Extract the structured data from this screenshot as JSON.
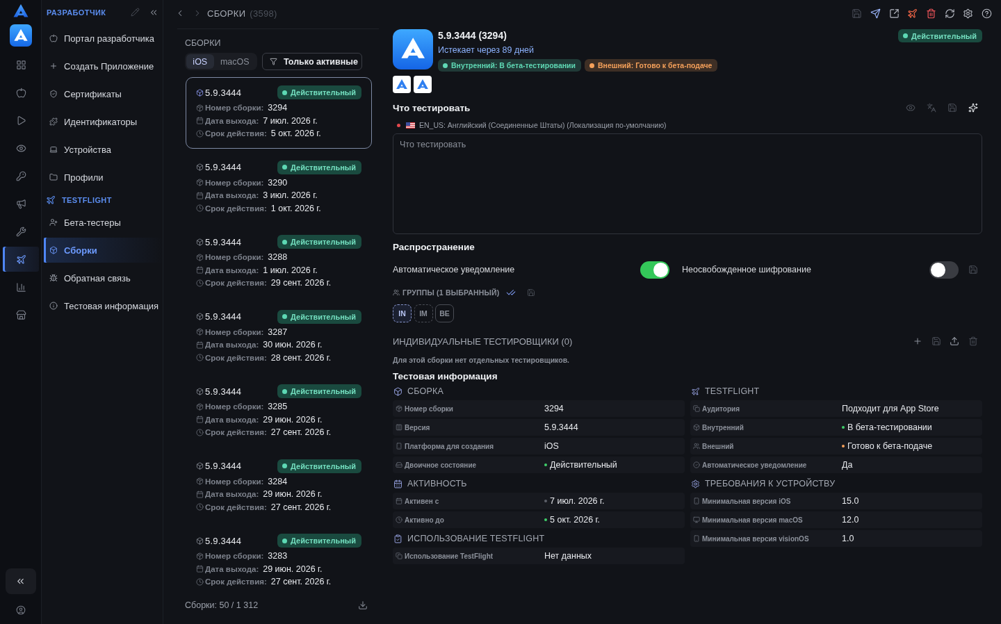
{
  "rail": {
    "items": [
      {
        "selected": false
      },
      {
        "selected": false
      },
      {
        "selected": false
      },
      {
        "selected": false
      },
      {
        "selected": false
      },
      {
        "selected": false
      },
      {
        "selected": false
      },
      {
        "selected": true
      },
      {
        "selected": false
      },
      {
        "selected": false
      }
    ]
  },
  "sidebar": {
    "sections": [
      {
        "title": "РАЗРАБОТЧИК",
        "items": [
          {
            "label": "Портал разработчика",
            "selected": false
          },
          {
            "label": "Создать Приложение",
            "selected": false
          },
          {
            "label": "Сертификаты",
            "selected": false
          },
          {
            "label": "Идентификаторы",
            "selected": false
          },
          {
            "label": "Устройства",
            "selected": false
          },
          {
            "label": "Профили",
            "selected": false
          }
        ]
      },
      {
        "title": "TESTFLIGHT",
        "items": [
          {
            "label": "Бета-тестеры",
            "selected": false
          },
          {
            "label": "Сборки",
            "selected": true
          },
          {
            "label": "Обратная связь",
            "selected": false
          },
          {
            "label": "Тестовая информация",
            "selected": false
          }
        ]
      }
    ]
  },
  "breadcrumb": {
    "title": "СБОРКИ",
    "count": "(3598)"
  },
  "toolbar": [
    {
      "disabled": true
    },
    {
      "disabled": false
    },
    {
      "disabled": false
    },
    {
      "disabled": false
    },
    {
      "disabled": false
    },
    {
      "disabled": false
    },
    {
      "disabled": false
    },
    {
      "disabled": false
    }
  ],
  "builds": {
    "title": "СБОРКИ",
    "platform_tabs": [
      {
        "label": "iOS",
        "selected": true
      },
      {
        "label": "macOS",
        "selected": false
      }
    ],
    "filter_button": "Только активные",
    "items": [
      {
        "version": "5.9.3444",
        "status": "Действительный",
        "selected": true,
        "fields": [
          {
            "label": "Номер сборки:",
            "value": "3294"
          },
          {
            "label": "Дата выхода:",
            "value": "7 июл. 2026 г."
          },
          {
            "label": "Срок действия:",
            "value": "5 окт. 2026 г."
          }
        ]
      },
      {
        "version": "5.9.3444",
        "status": "Действительный",
        "selected": false,
        "fields": [
          {
            "label": "Номер сборки:",
            "value": "3290"
          },
          {
            "label": "Дата выхода:",
            "value": "3 июл. 2026 г."
          },
          {
            "label": "Срок действия:",
            "value": "1 окт. 2026 г."
          }
        ]
      },
      {
        "version": "5.9.3444",
        "status": "Действительный",
        "selected": false,
        "fields": [
          {
            "label": "Номер сборки:",
            "value": "3288"
          },
          {
            "label": "Дата выхода:",
            "value": "1 июл. 2026 г."
          },
          {
            "label": "Срок действия:",
            "value": "29 сент. 2026 г."
          }
        ]
      },
      {
        "version": "5.9.3444",
        "status": "Действительный",
        "selected": false,
        "fields": [
          {
            "label": "Номер сборки:",
            "value": "3287"
          },
          {
            "label": "Дата выхода:",
            "value": "30 июн. 2026 г."
          },
          {
            "label": "Срок действия:",
            "value": "28 сент. 2026 г."
          }
        ]
      },
      {
        "version": "5.9.3444",
        "status": "Действительный",
        "selected": false,
        "fields": [
          {
            "label": "Номер сборки:",
            "value": "3285"
          },
          {
            "label": "Дата выхода:",
            "value": "29 июн. 2026 г."
          },
          {
            "label": "Срок действия:",
            "value": "27 сент. 2026 г."
          }
        ]
      },
      {
        "version": "5.9.3444",
        "status": "Действительный",
        "selected": false,
        "fields": [
          {
            "label": "Номер сборки:",
            "value": "3284"
          },
          {
            "label": "Дата выхода:",
            "value": "29 июн. 2026 г."
          },
          {
            "label": "Срок действия:",
            "value": "27 сент. 2026 г."
          }
        ]
      },
      {
        "version": "5.9.3444",
        "status": "Действительный",
        "selected": false,
        "fields": [
          {
            "label": "Номер сборки:",
            "value": "3283"
          },
          {
            "label": "Дата выхода:",
            "value": "29 июн. 2026 г."
          },
          {
            "label": "Срок действия:",
            "value": "27 сент. 2026 г."
          }
        ]
      }
    ],
    "footer": "Сборки: 50 / 1 312"
  },
  "detail": {
    "title": "5.9.3444 (3294)",
    "subtitle": "Истекает через 89 дней",
    "badges": [
      {
        "text": "Внутренний: В бета-тестировании",
        "color": "#5fd9b5"
      },
      {
        "text": "Внешний: Готово к бета-подаче",
        "color": "#f5a05a"
      }
    ],
    "status": "Действительный",
    "what_to_test": {
      "title": "Что тестировать",
      "locale": "EN_US: Английский (Соединенные Штаты) (Локализация по-умолчанию)",
      "placeholder": "Что тестировать"
    },
    "distribution": {
      "title": "Распространение",
      "toggles": [
        {
          "label": "Автоматическое уведомление",
          "on": true
        },
        {
          "label": "Неосвобожденное шифрование",
          "on": false
        }
      ],
      "groups_label": "ГРУППЫ (1 ВЫБРАННЫЙ)",
      "groups": [
        {
          "label": "IN",
          "selected": true,
          "kind": "internal"
        },
        {
          "label": "IM",
          "selected": false,
          "kind": "internal"
        },
        {
          "label": "BE",
          "selected": false,
          "kind": "external"
        }
      ]
    },
    "individual": {
      "title": "ИНДИВИДУАЛЬНЫЕ ТЕСТИРОВЩИКИ (0)",
      "note": "Для этой сборки нет отдельных тестировщиков."
    },
    "test_info": {
      "title": "Тестовая информация",
      "columns": [
        {
          "sections": [
            {
              "title": "СБОРКА",
              "rows": [
                {
                  "label": "Номер сборки",
                  "value": "3294"
                },
                {
                  "label": "Версия",
                  "value": "5.9.3444"
                },
                {
                  "label": "Платформа для создания",
                  "value": "iOS"
                },
                {
                  "label": "Двоичное состояние",
                  "value": "Действительный",
                  "color": "#3fcf6a"
                }
              ]
            },
            {
              "title": "АКТИВНОСТЬ",
              "rows": [
                {
                  "label": "Активен с",
                  "value": "7 июл. 2026 г.",
                  "color": "#5c6069"
                },
                {
                  "label": "Активно до",
                  "value": "5 окт. 2026 г.",
                  "color": "#3fcf6a"
                }
              ]
            },
            {
              "title": "ИСПОЛЬЗОВАНИЕ TESTFLIGHT",
              "rows": [
                {
                  "label": "Использование TestFlight",
                  "value": "Нет данных"
                }
              ]
            }
          ]
        },
        {
          "sections": [
            {
              "title": "TESTFLIGHT",
              "rows": [
                {
                  "label": "Аудитория",
                  "value": "Подходит для App Store"
                },
                {
                  "label": "Внутренний",
                  "value": "В бета-тестировании",
                  "color": "#3fcf6a"
                },
                {
                  "label": "Внешний",
                  "value": "Готово к бета-подаче",
                  "color": "#f5a05a"
                },
                {
                  "label": "Автоматическое уведомление",
                  "value": "Да"
                }
              ]
            },
            {
              "title": "ТРЕБОВАНИЯ К УСТРОЙСТВУ",
              "rows": [
                {
                  "label": "Минимальная версия iOS",
                  "value": "15.0"
                },
                {
                  "label": "Минимальная версия macOS",
                  "value": "12.0"
                },
                {
                  "label": "Минимальная версия visionOS",
                  "value": "1.0"
                }
              ]
            }
          ]
        }
      ]
    }
  }
}
